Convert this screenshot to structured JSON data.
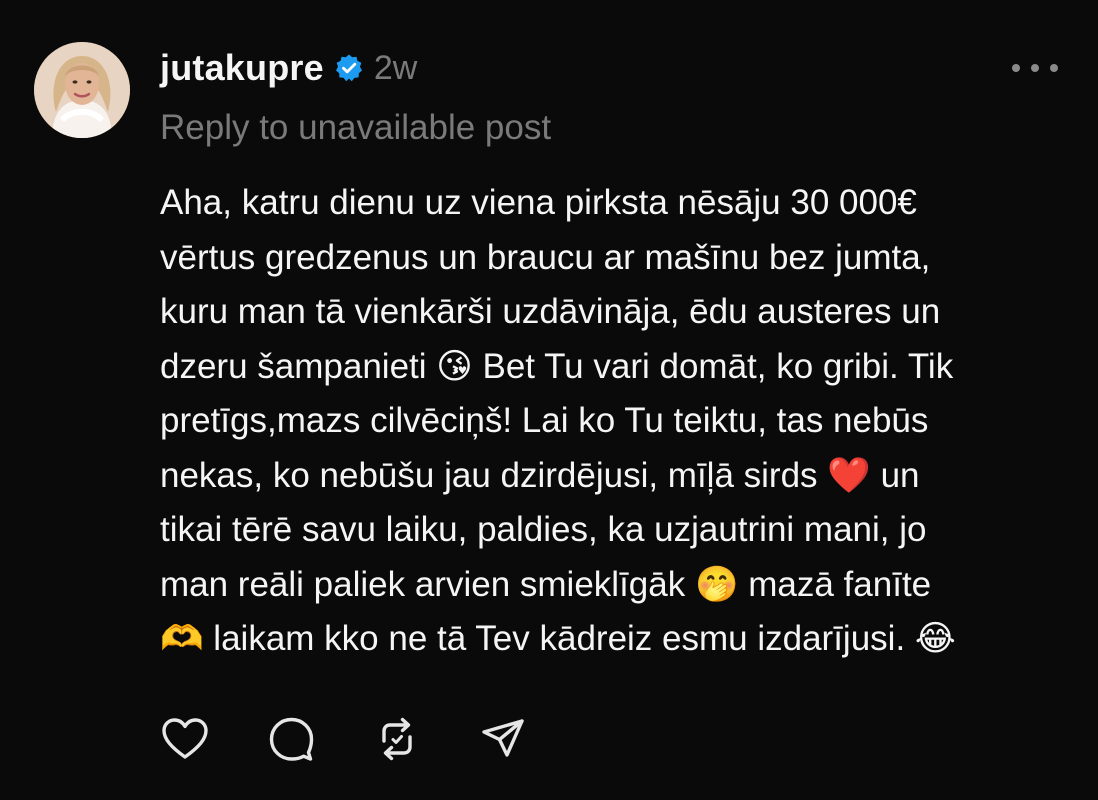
{
  "post": {
    "author": {
      "username": "jutakupre",
      "verified": true,
      "avatar_icon": "profile-photo"
    },
    "timestamp": "2w",
    "reply_note": "Reply to unavailable post",
    "more_icon": "more-horizontal-icon",
    "body_lines": [
      "Aha, katru dienu uz viena pirksta nēsāju 30 000€",
      "vērtus gredzenus un braucu ar mašīnu bez jumta,",
      "kuru man tā vienkārši uzdāvināja, ēdu austeres un",
      "dzeru šampanieti 😘 Bet Tu vari domāt, ko gribi. Tik",
      "pretīgs,mazs cilvēciņš! Lai ko Tu teiktu, tas nebūs",
      "nekas, ko nebūšu jau dzirdējusi, mīļā sirds ❤️ un",
      "tikai tērē savu laiku, paldies, ka uzjautrini mani, jo",
      "man reāli paliek arvien smieklīgāk 🤭 mazā fanīte",
      "🫶 laikam kko ne tā Tev kādreiz esmu izdarījusi. 😂"
    ],
    "actions": [
      {
        "name": "like",
        "icon": "heart-icon"
      },
      {
        "name": "comment",
        "icon": "speech-bubble-icon"
      },
      {
        "name": "repost",
        "icon": "repost-icon"
      },
      {
        "name": "share",
        "icon": "send-icon"
      }
    ],
    "colors": {
      "background": "#0a0a0a",
      "text": "#f5f5f5",
      "muted": "#7a7a7a",
      "verified": "#1d9bf0"
    }
  }
}
